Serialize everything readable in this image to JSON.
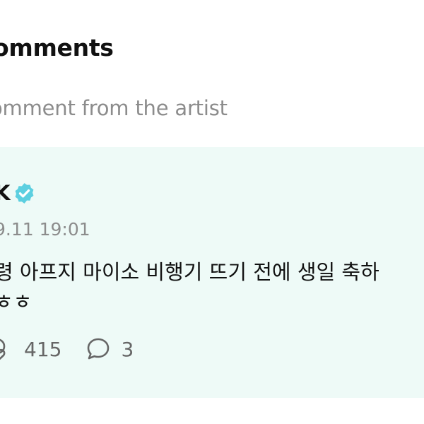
{
  "header": {
    "title": "omments"
  },
  "filter": {
    "label": "omment from the artist"
  },
  "comment": {
    "author": "K",
    "verified_icon": "verified-badge-icon",
    "timestamp": "9.11 19:01",
    "body_lines": [
      "령 아프지 마이소 비행기 뜨기 전에 생일 축하",
      "ㅎㅎ"
    ],
    "actions": {
      "likes": {
        "icon": "like-icon",
        "count": "415"
      },
      "replies": {
        "icon": "reply-bubble-icon",
        "count": "3"
      }
    }
  },
  "colors": {
    "card_background": "#eefaf7",
    "verified_badge": "#5ccfe0",
    "muted_text": "#8c8c8c",
    "icon_stroke": "#666666"
  }
}
